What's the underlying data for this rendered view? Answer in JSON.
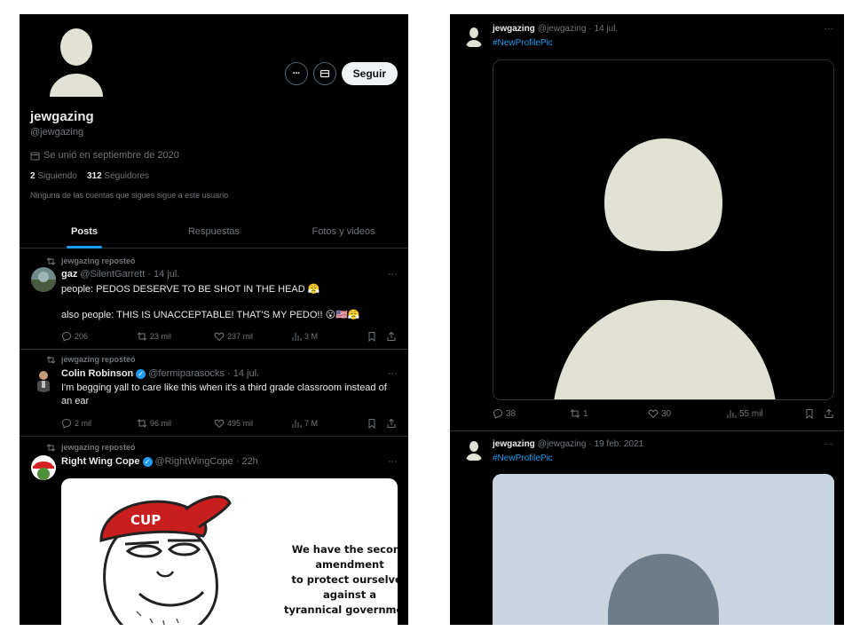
{
  "profile": {
    "name": "jewgazing",
    "handle": "@jewgazing",
    "joined": "Se unió en septiembre de 2020",
    "following_count": "2",
    "following_label": "Siguiendo",
    "followers_count": "312",
    "followers_label": "Seguidores",
    "mutuals_note": "Ninguna de las cuentas que sigues sigue a este usuario",
    "follow_button": "Seguir",
    "more_icon": "ellipsis-icon",
    "message_icon": "envelope-icon"
  },
  "tabs": [
    {
      "label": "Posts",
      "active": true
    },
    {
      "label": "Respuestas",
      "active": false
    },
    {
      "label": "Fotos y videos",
      "active": false
    }
  ],
  "posts": [
    {
      "repost_label": "jewgazing reposteó",
      "author": "gaz",
      "handle": "@SilentGarrett",
      "time": "· 14 jul.",
      "text_line1": "people: PEDOS DESERVE TO BE SHOT IN THE HEAD 😤",
      "text_line2": "also people: THIS IS UNACCEPTABLE! THAT'S MY PEDO!! 😮🇺🇸😤",
      "replies": "206",
      "reposts": "23 mil",
      "likes": "237 mil",
      "views": "3 M"
    },
    {
      "repost_label": "jewgazing reposteó",
      "author": "Colin Robinson",
      "handle": "@fermiparasocks",
      "time": "· 14 jul.",
      "text_line1": "I'm begging yall to care like this when it's a third grade classroom instead of",
      "text_line2": "an ear",
      "replies": "2 mil",
      "reposts": "96 mil",
      "likes": "495 mil",
      "views": "7 M"
    },
    {
      "repost_label": "jewgazing reposteó",
      "author": "Right Wing Cope",
      "handle": "@RightWingCope",
      "time": "· 22h",
      "meme_line1": "We have the second amendment",
      "meme_line2": "to protect ourselves against a",
      "meme_line3": "tyrannical government",
      "cap_text": "CUP"
    }
  ],
  "right_posts": [
    {
      "author": "jewgazing",
      "handle": "@jewgazing",
      "time": "· 14 jul.",
      "hashtag": "#NewProfilePic",
      "replies": "38",
      "reposts": "1",
      "likes": "30",
      "views": "55 mil"
    },
    {
      "author": "jewgazing",
      "handle": "@jewgazing",
      "time": "· 19 feb. 2021",
      "hashtag": "#NewProfilePic"
    }
  ],
  "more_glyph": "···",
  "colors": {
    "accent": "#1d9bf0",
    "background": "#000000",
    "muted": "#71767b",
    "avatar": "#e1e1d4"
  }
}
